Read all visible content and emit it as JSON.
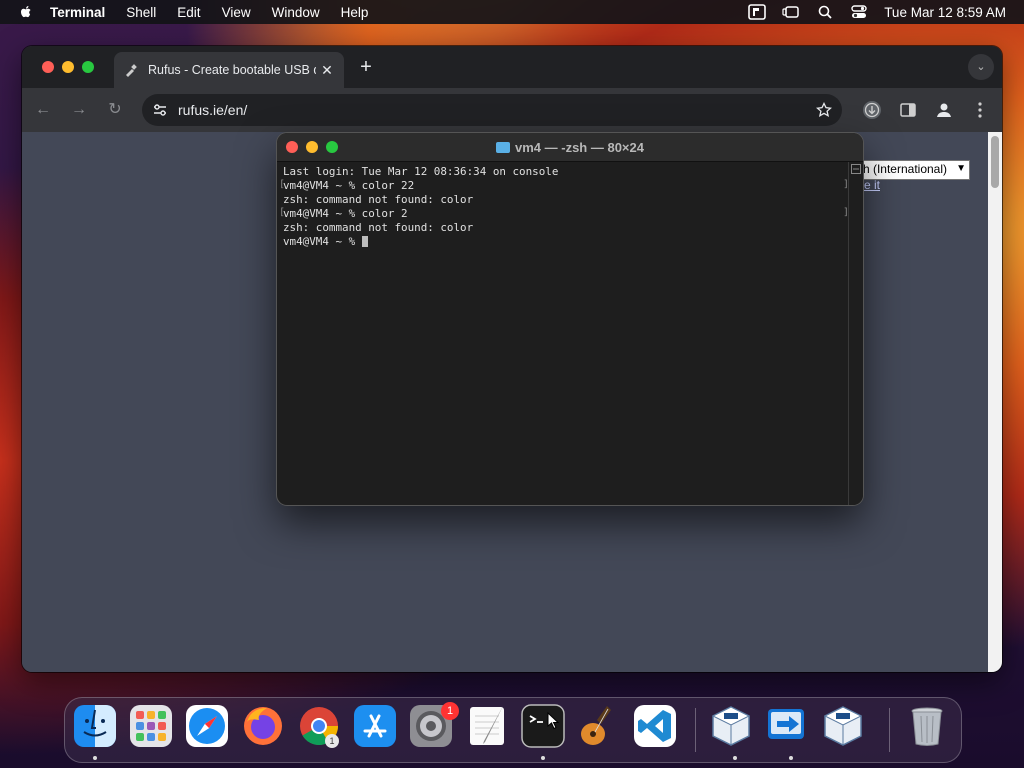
{
  "menubar": {
    "app_name": "Terminal",
    "items": [
      "Shell",
      "Edit",
      "View",
      "Window",
      "Help"
    ],
    "clock": "Tue Mar 12  8:59 AM"
  },
  "browser": {
    "tab_title": "Rufus - Create bootable USB drives the easy way",
    "url": "rufus.ie/en/",
    "language_select_value": "English (International)",
    "help_link": "Like it?"
  },
  "terminal": {
    "title": "vm4 — -zsh — 80×24",
    "lines": [
      "Last login: Tue Mar 12 08:36:34 on console",
      "vm4@VM4 ~ % color 22",
      "zsh: command not found: color",
      "vm4@VM4 ~ % color 2",
      "zsh: command not found: color",
      "vm4@VM4 ~ % "
    ]
  },
  "dock": {
    "apps": [
      {
        "name": "Finder",
        "icon": "finder-icon"
      },
      {
        "name": "Launchpad",
        "icon": "launchpad-icon"
      },
      {
        "name": "Safari",
        "icon": "safari-icon"
      },
      {
        "name": "Firefox",
        "icon": "firefox-icon"
      },
      {
        "name": "Google Chrome",
        "icon": "chrome-icon"
      },
      {
        "name": "App Store",
        "icon": "app-store-icon"
      },
      {
        "name": "System Settings",
        "icon": "system-settings-icon"
      },
      {
        "name": "TextEdit",
        "icon": "textedit-icon"
      },
      {
        "name": "Terminal",
        "icon": "terminal-icon"
      },
      {
        "name": "GarageBand",
        "icon": "garageband-icon"
      },
      {
        "name": "Visual Studio Code",
        "icon": "vscode-icon"
      },
      {
        "name": "VirtualBox",
        "icon": "virtualbox-icon"
      },
      {
        "name": "Migration Assistant",
        "icon": "migration-assistant-icon"
      },
      {
        "name": "VirtualBox",
        "icon": "virtualbox-icon"
      },
      {
        "name": "Trash",
        "icon": "trash-icon"
      }
    ],
    "settings_badge": "1",
    "chrome_badge": "1"
  },
  "colors": {
    "terminal_bg": "#1e1e1e",
    "page_bg": "#434857",
    "close": "#fe5f57",
    "minimize": "#febc2e",
    "zoom": "#28c840"
  }
}
